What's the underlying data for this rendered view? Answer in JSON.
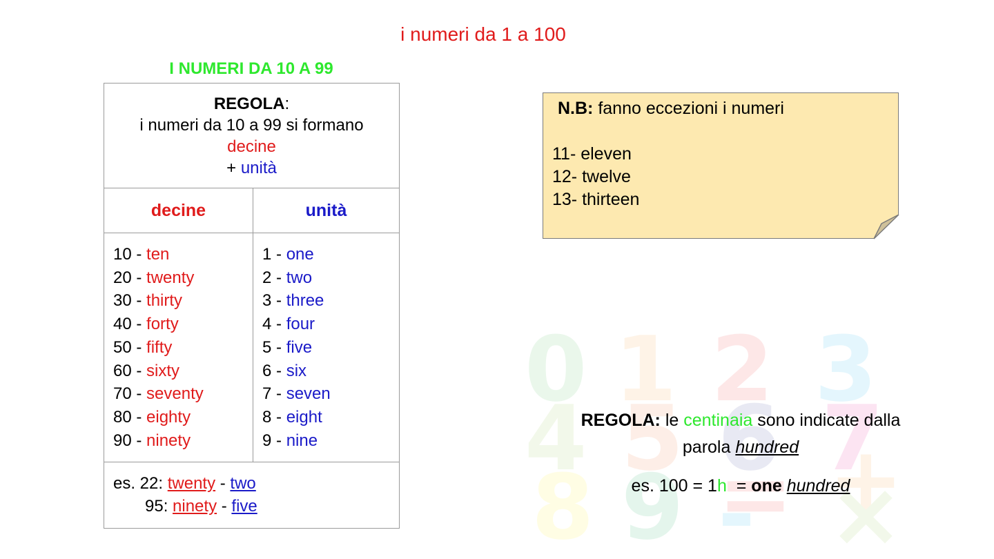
{
  "title": "i numeri da 1 a 100",
  "subtitle": "I NUMERI DA 10 A 99",
  "rule_box": {
    "label": "REGOLA",
    "colon": ":",
    "line1": "i numeri da 10 a 99 si formano",
    "line2": "decine",
    "line3_plus": "+ ",
    "line3_word": "unità"
  },
  "table": {
    "header_tens": "decine",
    "header_units": "unità",
    "tens": [
      {
        "num": "10 - ",
        "word": "ten"
      },
      {
        "num": "20 - ",
        "word": "twenty"
      },
      {
        "num": "30 - ",
        "word": "thirty"
      },
      {
        "num": "40 - ",
        "word": "forty"
      },
      {
        "num": "50 - ",
        "word": "fifty"
      },
      {
        "num": "60 - ",
        "word": "sixty"
      },
      {
        "num": "70 - ",
        "word": "seventy"
      },
      {
        "num": "80 - ",
        "word": "eighty"
      },
      {
        "num": "90 - ",
        "word": "ninety"
      }
    ],
    "units": [
      {
        "num": "1 - ",
        "word": "one"
      },
      {
        "num": "2 - ",
        "word": "two"
      },
      {
        "num": "3 - ",
        "word": "three"
      },
      {
        "num": "4 - ",
        "word": "four"
      },
      {
        "num": "5 - ",
        "word": "five"
      },
      {
        "num": "6 - ",
        "word": "six"
      },
      {
        "num": "7 - ",
        "word": "seven"
      },
      {
        "num": "8 - ",
        "word": "eight"
      },
      {
        "num": "9 - ",
        "word": "nine"
      }
    ],
    "examples": [
      {
        "prefix": "es. 22: ",
        "tens": "twenty",
        "sep": " - ",
        "units": "two"
      },
      {
        "prefix": "95: ",
        "tens": "ninety",
        "sep": " - ",
        "units": "five"
      }
    ]
  },
  "note": {
    "label": "N.B:",
    "text": " fanno eccezioni i numeri",
    "items": [
      "11- eleven",
      "12- twelve",
      "13- thirteen"
    ]
  },
  "rule2": {
    "label": "REGOLA:",
    "before": " le ",
    "highlight": "centinaia",
    "after": " sono indicate dalla",
    "line2_before": "parola ",
    "line2_word": "hundred"
  },
  "example2": {
    "prefix": "es. 100 = 1",
    "h": "h",
    "eq": "  = ",
    "bold": "one",
    "space": " ",
    "word": "hundred"
  },
  "watermark": {
    "digits": [
      "0",
      "1",
      "2",
      "3",
      "4",
      "5",
      "6",
      "7",
      "8",
      "9",
      "=",
      "-",
      "+",
      "×"
    ],
    "colors": [
      "#39b54a",
      "#f7941d",
      "#ed1c24",
      "#00aeef",
      "#8dc63f",
      "#f26522",
      "#2e3192",
      "#ec008c",
      "#fff200",
      "#00a651",
      "#ed1c24",
      "#00aeef",
      "#f7941d",
      "#8dc63f"
    ]
  }
}
